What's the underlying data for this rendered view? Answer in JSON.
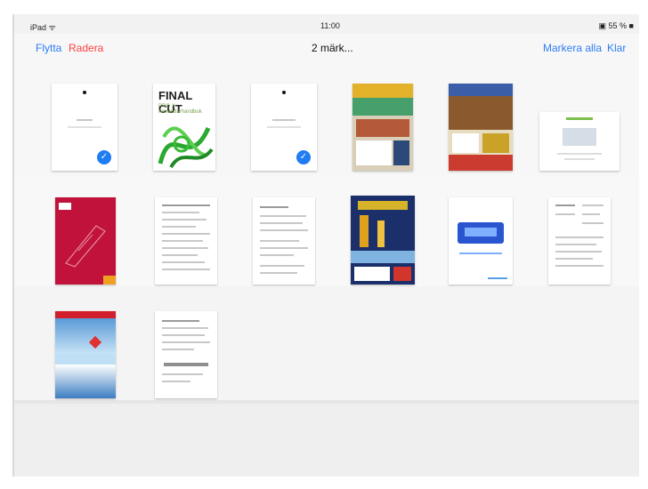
{
  "status_bar": {
    "left": "iPad ᯤ",
    "center": "11:00",
    "right": "▣ 55 % ■"
  },
  "nav": {
    "move": "Flytta",
    "delete": "Radera",
    "title": "2 märk...",
    "mark_all": "Markera alla",
    "done": "Klar"
  },
  "books": [
    {
      "id": "doc-1",
      "selected": true
    },
    {
      "id": "final-cut-guide",
      "cover_title": "FINAL CUT",
      "cover_subtitle": "PRO X · Användarhandbok",
      "selected": false
    },
    {
      "id": "doc-3",
      "selected": true
    },
    {
      "id": "magazine-1",
      "selected": false
    },
    {
      "id": "magazine-2",
      "selected": false
    },
    {
      "id": "doc-6",
      "selected": false
    },
    {
      "id": "red-book",
      "selected": false
    },
    {
      "id": "text-doc-1",
      "selected": false
    },
    {
      "id": "text-doc-2",
      "selected": false
    },
    {
      "id": "magazine-3",
      "selected": false
    },
    {
      "id": "tech-doc",
      "selected": false
    },
    {
      "id": "spec-doc",
      "selected": false
    },
    {
      "id": "travel-book",
      "selected": false
    },
    {
      "id": "letter-doc",
      "selected": false
    }
  ],
  "colors": {
    "accent": "#2f7df6",
    "destructive": "#ff4040",
    "check": "#1f7cf2"
  }
}
